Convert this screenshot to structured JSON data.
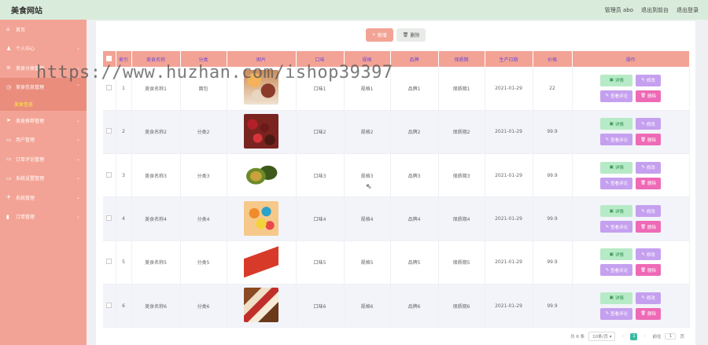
{
  "topbar": {
    "brand": "美食网站",
    "user_label": "管理员 abo",
    "front_link": "退出到前台",
    "logout_link": "退出登录"
  },
  "watermark": "https://www.huzhan.com/ishop39397",
  "sidebar": {
    "items": [
      {
        "label": "首页",
        "icon": "home-icon",
        "glyph": "⌂",
        "has_children": false
      },
      {
        "label": "个人中心",
        "icon": "user-icon",
        "glyph": "♟",
        "has_children": true
      },
      {
        "label": "美食分类管理",
        "icon": "list-icon",
        "glyph": "≡",
        "has_children": true
      },
      {
        "label": "美食信息管理",
        "icon": "info-icon",
        "glyph": "◷",
        "has_children": true,
        "open": true,
        "sub": "美食信息"
      },
      {
        "label": "美食推荐管理",
        "icon": "send-icon",
        "glyph": "➤",
        "has_children": true
      },
      {
        "label": "用户管理",
        "icon": "users-icon",
        "glyph": "▭",
        "has_children": true
      },
      {
        "label": "订单评论管理",
        "icon": "comment-icon",
        "glyph": "▭",
        "has_children": true
      },
      {
        "label": "系统设置管理",
        "icon": "settings-icon",
        "glyph": "▭",
        "has_children": true
      },
      {
        "label": "系统管理",
        "icon": "plane-icon",
        "glyph": "✈",
        "has_children": true
      },
      {
        "label": "订单管理",
        "icon": "chart-icon",
        "glyph": "▮",
        "has_children": true
      }
    ]
  },
  "toolbar": {
    "add_label": "新增",
    "delete_label": "删除"
  },
  "table": {
    "headers": [
      "索引",
      "美食名称",
      "分类",
      "图片",
      "口味",
      "规格",
      "品牌",
      "保质期",
      "生产日期",
      "价格",
      "操作"
    ],
    "rows": [
      {
        "index": "1",
        "name": "美食名称1",
        "category": "面包",
        "flavor": "口味1",
        "spec": "规格1",
        "brand": "品牌1",
        "shelf": "保质期1",
        "date": "2021-01-29",
        "price": "22",
        "thumb": "thumb-1"
      },
      {
        "index": "2",
        "name": "美食名称2",
        "category": "分类2",
        "flavor": "口味2",
        "spec": "规格2",
        "brand": "品牌2",
        "shelf": "保质期2",
        "date": "2021-01-29",
        "price": "99.9",
        "thumb": "thumb-2"
      },
      {
        "index": "3",
        "name": "美食名称3",
        "category": "分类3",
        "flavor": "口味3",
        "spec": "规格3",
        "brand": "品牌3",
        "shelf": "保质期3",
        "date": "2021-01-29",
        "price": "99.9",
        "thumb": "thumb-3"
      },
      {
        "index": "4",
        "name": "美食名称4",
        "category": "分类4",
        "flavor": "口味4",
        "spec": "规格4",
        "brand": "品牌4",
        "shelf": "保质期4",
        "date": "2021-01-29",
        "price": "99.9",
        "thumb": "thumb-4"
      },
      {
        "index": "5",
        "name": "美食名称5",
        "category": "分类5",
        "flavor": "口味5",
        "spec": "规格5",
        "brand": "品牌5",
        "shelf": "保质期5",
        "date": "2021-01-29",
        "price": "99.9",
        "thumb": "thumb-5"
      },
      {
        "index": "6",
        "name": "美食名称6",
        "category": "分类6",
        "flavor": "口味6",
        "spec": "规格6",
        "brand": "品牌6",
        "shelf": "保质期6",
        "date": "2021-01-29",
        "price": "99.9",
        "thumb": "thumb-6"
      }
    ],
    "actions": {
      "detail": "详情",
      "edit": "修改",
      "review": "查看评论",
      "delete": "删除"
    }
  },
  "pager": {
    "total": "共 6 条",
    "page_size": "10条/页",
    "current": "1",
    "goto_label": "前往",
    "goto_value": "1",
    "page_unit": "页"
  },
  "colors": {
    "accent": "#f3a395",
    "topbar": "#d9ecdb",
    "header_text": "#6a4ad8",
    "submenu_active": "#fcef3a"
  }
}
